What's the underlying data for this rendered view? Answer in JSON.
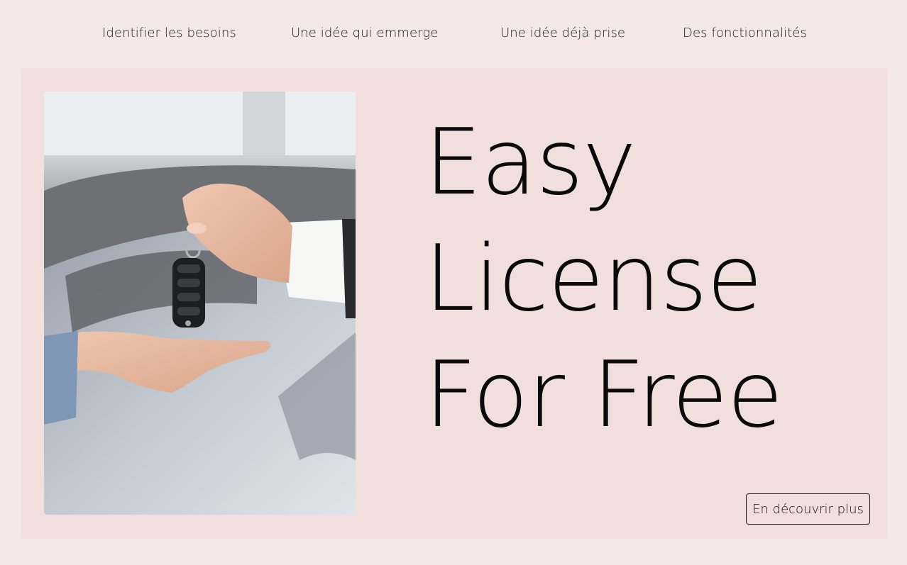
{
  "nav": {
    "items": [
      {
        "label": "Identifier les besoins"
      },
      {
        "label": "Une idée qui emmerge"
      },
      {
        "label": "Une idée déjà prise"
      },
      {
        "label": "Des fonctionnalités"
      }
    ]
  },
  "hero": {
    "image_description_icon": "car-key-handover-photo-icon",
    "headline_lines": [
      "Easy",
      "License",
      "For Free"
    ],
    "cta_label": "En découvrir plus"
  },
  "colors": {
    "page_background": "#f5e9e6",
    "hero_background": "#f0dfdc",
    "text": "#0a0a0a"
  }
}
